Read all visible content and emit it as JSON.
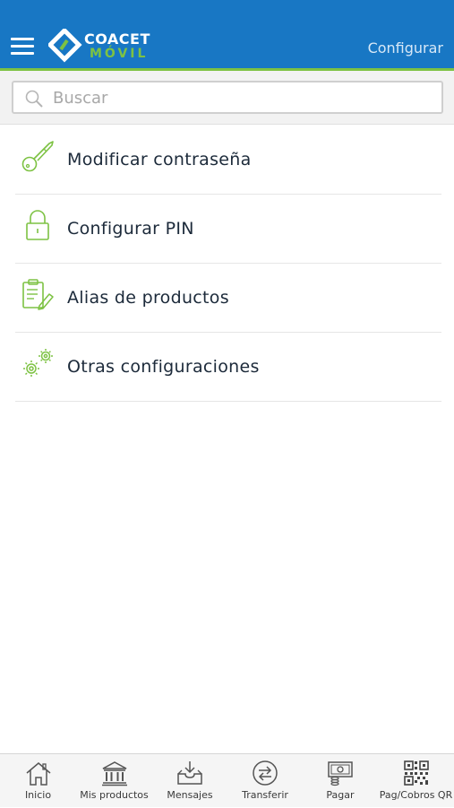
{
  "header": {
    "logo_line1": "COACET",
    "logo_line2": "MÓVIL",
    "action_label": "Configurar",
    "brand_color": "#1877c4",
    "accent_color": "#7dc243"
  },
  "search": {
    "placeholder": "Buscar",
    "value": ""
  },
  "menu": {
    "items": [
      {
        "label": "Modificar contraseña",
        "icon": "key-icon"
      },
      {
        "label": "Configurar PIN",
        "icon": "padlock-icon"
      },
      {
        "label": "Alias de productos",
        "icon": "clipboard-edit-icon"
      },
      {
        "label": "Otras configuraciones",
        "icon": "gears-icon"
      }
    ]
  },
  "tabbar": {
    "tabs": [
      {
        "label": "Inicio",
        "icon": "home-icon"
      },
      {
        "label": "Mis productos",
        "icon": "bank-icon"
      },
      {
        "label": "Mensajes",
        "icon": "inbox-icon"
      },
      {
        "label": "Transferir",
        "icon": "transfer-icon"
      },
      {
        "label": "Pagar",
        "icon": "payment-icon"
      },
      {
        "label": "Pag/Cobros QR",
        "icon": "qr-code-icon"
      }
    ]
  }
}
